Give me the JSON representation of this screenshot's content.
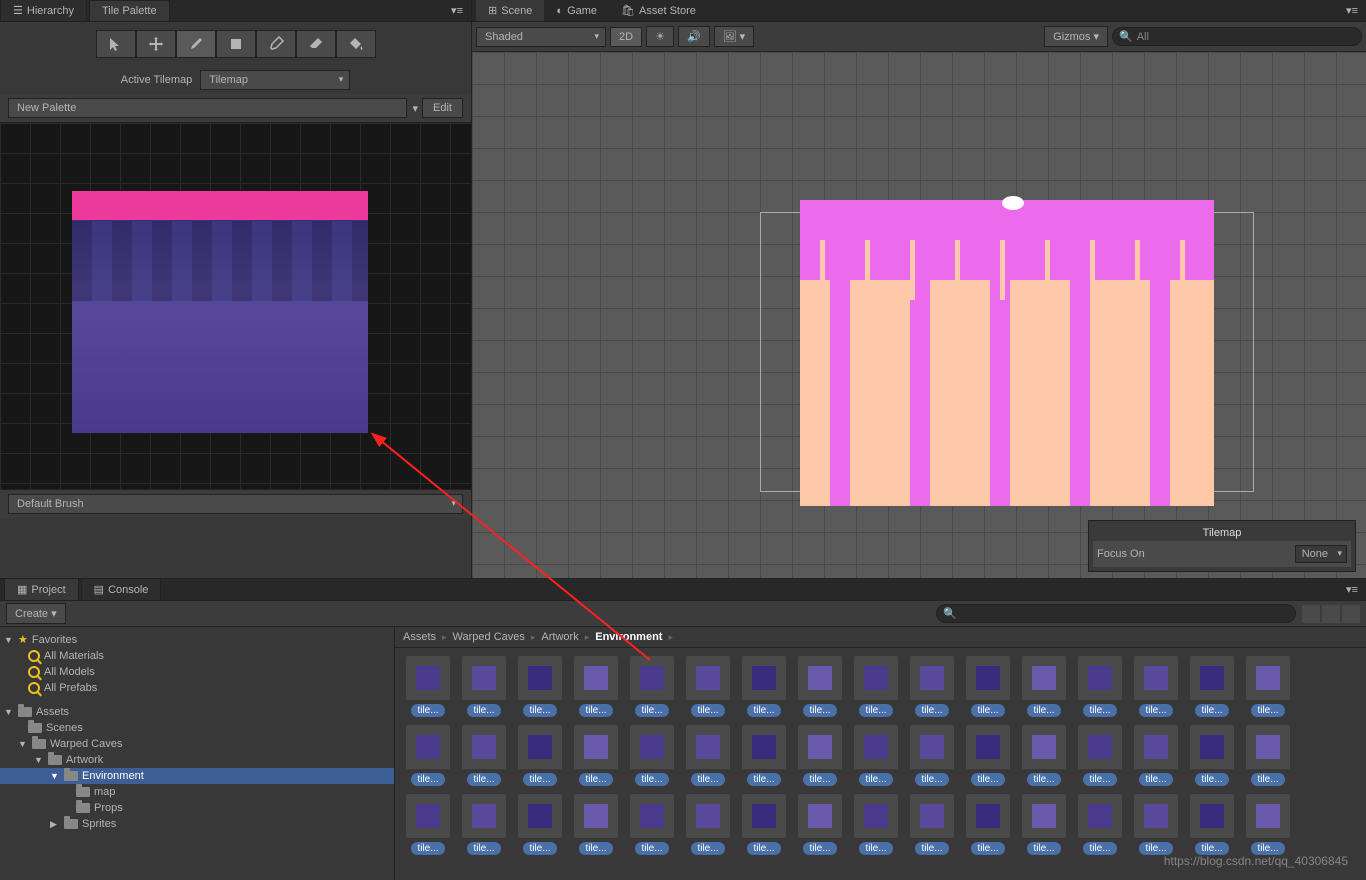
{
  "leftTabs": {
    "hierarchy": "Hierarchy",
    "tilePalette": "Tile Palette"
  },
  "tilePalette": {
    "activeTilemapLabel": "Active Tilemap",
    "tilemapDropdown": "Tilemap",
    "paletteDropdown": "New Palette",
    "editButton": "Edit",
    "brushDropdown": "Default Brush"
  },
  "sceneTabs": {
    "scene": "Scene",
    "game": "Game",
    "assetStore": "Asset Store"
  },
  "sceneToolbar": {
    "shaded": "Shaded",
    "mode2d": "2D",
    "gizmos": "Gizmos",
    "searchPlaceholder": "All"
  },
  "focusOverlay": {
    "title": "Tilemap",
    "label": "Focus On",
    "value": "None"
  },
  "bottomTabs": {
    "project": "Project",
    "console": "Console"
  },
  "projectToolbar": {
    "create": "Create"
  },
  "tree": {
    "favorites": "Favorites",
    "allMaterials": "All Materials",
    "allModels": "All Models",
    "allPrefabs": "All Prefabs",
    "assets": "Assets",
    "scenes": "Scenes",
    "warpedCaves": "Warped Caves",
    "artwork": "Artwork",
    "environment": "Environment",
    "map": "map",
    "props": "Props",
    "sprites": "Sprites"
  },
  "breadcrumb": {
    "assets": "Assets",
    "warpedCaves": "Warped Caves",
    "artwork": "Artwork",
    "environment": "Environment"
  },
  "assetLabel": "tile...",
  "watermark": "https://blog.csdn.net/qq_40306845"
}
